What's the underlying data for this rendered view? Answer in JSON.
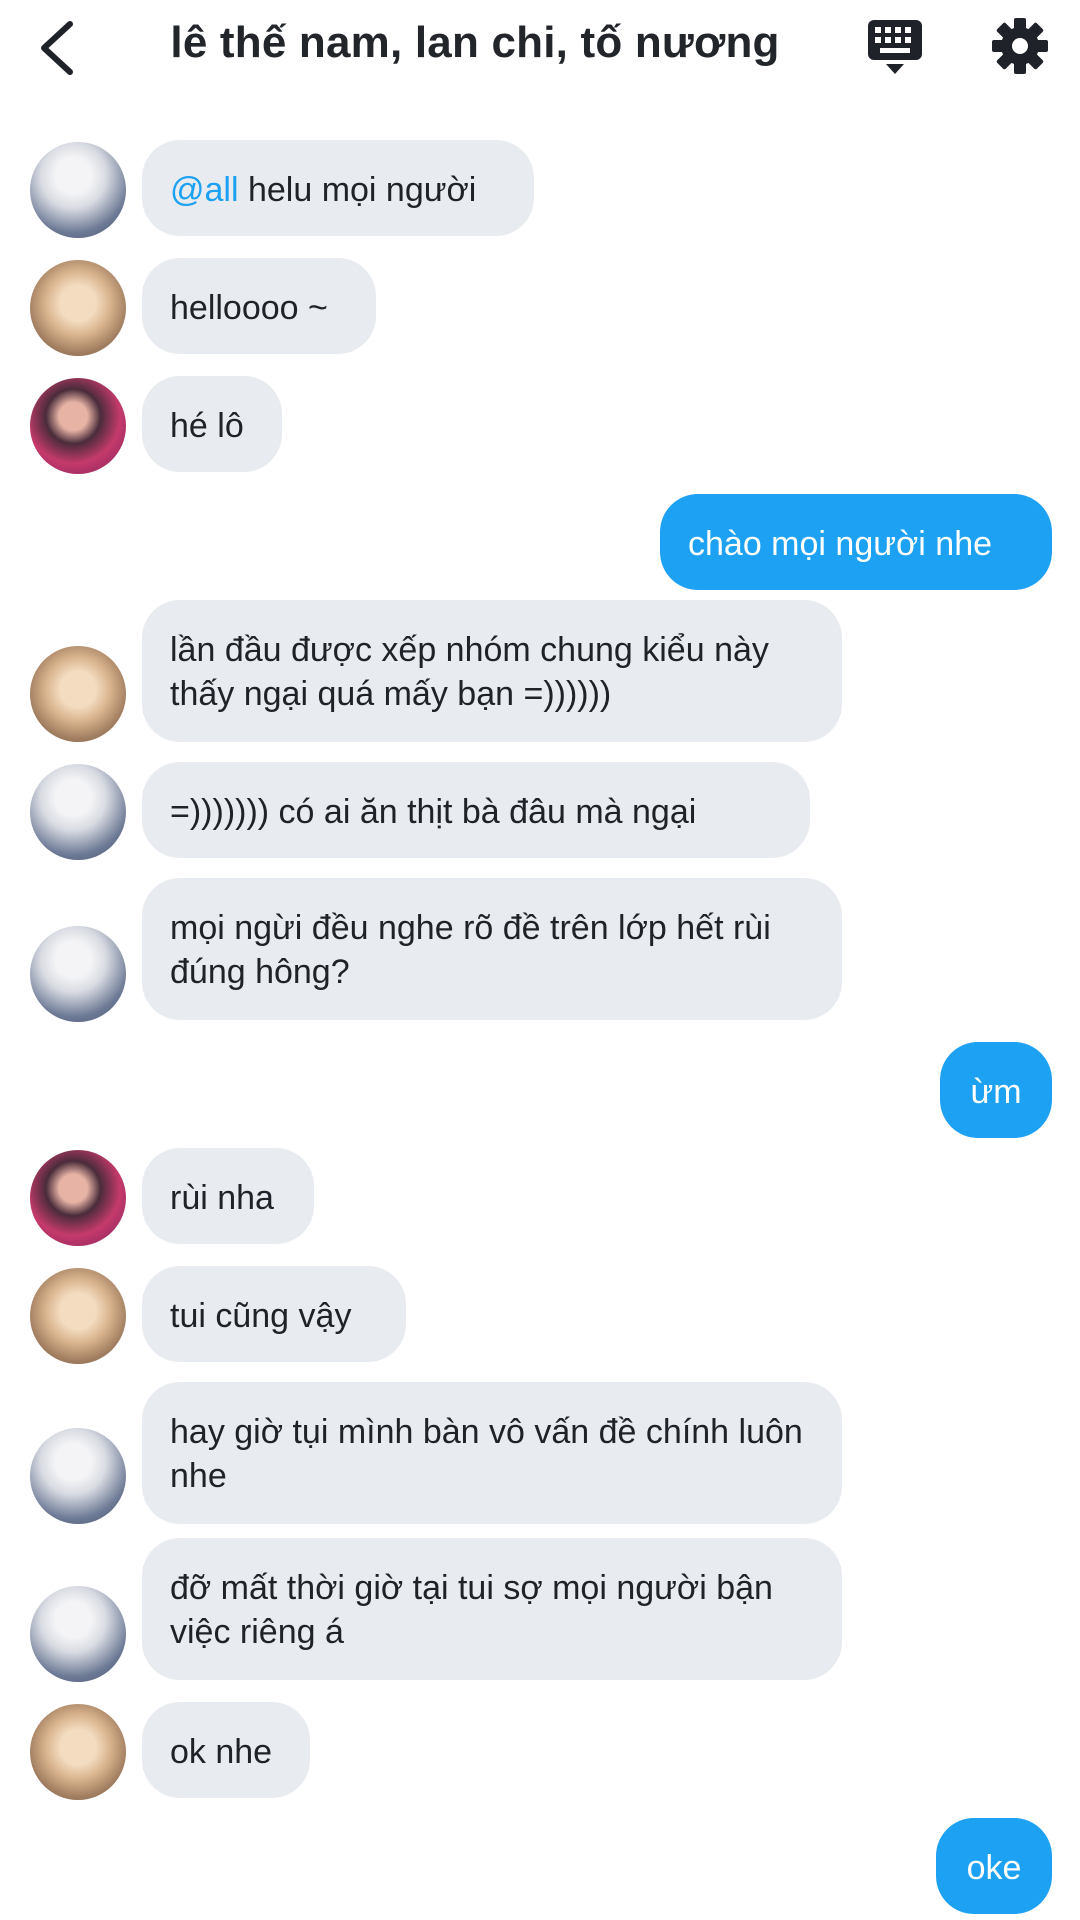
{
  "header": {
    "title": "lê thế nam, lan chi, tố nương",
    "back_icon": "chevron-left-icon",
    "keyboard_icon": "keyboard-icon",
    "settings_icon": "gear-icon"
  },
  "colors": {
    "outgoing_bubble": "#1da1f2",
    "incoming_bubble": "#e8ebef",
    "mention": "#1da1f2"
  },
  "messages": [
    {
      "sender": "white-shirt",
      "mention": "@all",
      "text": " helu mọi người"
    },
    {
      "sender": "cat",
      "text": "helloooo ~"
    },
    {
      "sender": "girl",
      "text": "hé lô"
    },
    {
      "sender": "me",
      "text": "chào mọi người nhe"
    },
    {
      "sender": "cat",
      "text": "lần đầu được xếp nhóm chung kiểu này thấy ngại quá mấy bạn =))))))"
    },
    {
      "sender": "white-shirt",
      "text": "=))))))) có ai ăn thịt bà đâu mà ngại"
    },
    {
      "sender": "white-shirt",
      "text": "mọi ngừi đều nghe rõ đề trên lớp hết rùi đúng hông?"
    },
    {
      "sender": "me",
      "text": "ừm"
    },
    {
      "sender": "girl",
      "text": "rùi nha"
    },
    {
      "sender": "cat",
      "text": "tui cũng vậy"
    },
    {
      "sender": "white-shirt",
      "text": "hay giờ tụi mình bàn vô vấn đề chính luôn nhe"
    },
    {
      "sender": "white-shirt",
      "text": "đỡ mất thời giờ tại tui sợ mọi người bận việc riêng á"
    },
    {
      "sender": "cat",
      "text": "ok nhe"
    },
    {
      "sender": "me",
      "text": "oke"
    }
  ]
}
